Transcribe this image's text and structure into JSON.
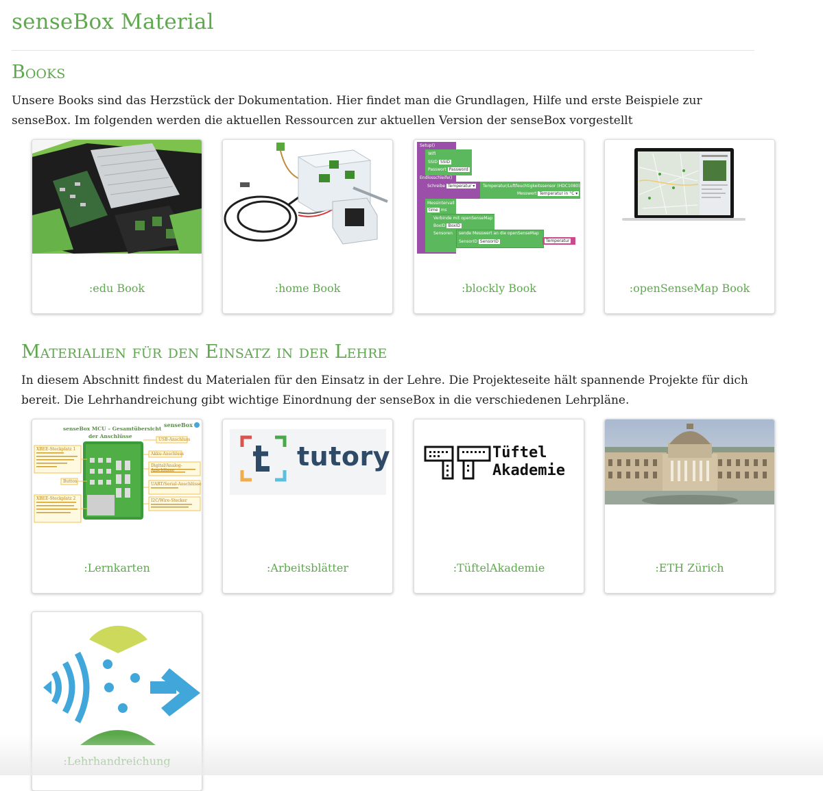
{
  "page": {
    "title": "senseBox Material"
  },
  "books": {
    "title": "Books",
    "description": "Unsere Books sind das Herzstück der Dokumentation. Hier findet man die Grundlagen, Hilfe und erste Beispiele zur senseBox. Im folgenden werden die aktuellen Ressourcen zur aktuellen Version der senseBox vorgestellt",
    "cards": [
      {
        "label": ":edu Book"
      },
      {
        "label": ":home Book"
      },
      {
        "label": ":blockly Book"
      },
      {
        "label": ":openSenseMap Book"
      }
    ]
  },
  "blockly_preview": {
    "setup": "Setup()",
    "wifi": "Wifi",
    "ssid": "SSID",
    "ssid_value": "SSID",
    "password": "Passwort",
    "password_value": "Password",
    "loop": "Endlosschleife()",
    "write": "Schreibe",
    "write_value": "Temperatur ▾",
    "sensor": "Temperatur/Luftfeuchtigkeitssensor (HDC1080)",
    "measure": "Messwert",
    "measure_value": "Temperatur in °C ▾",
    "interval": "Messintervall",
    "time": "time",
    "ms": "ms",
    "connect": "Verbinde mit openSenseMap",
    "boxid": "BoxID",
    "boxid_value": "BoxID",
    "sensors": "Sensoren",
    "send": "sende Messwert an die openSenseMap",
    "sensorid": "SensorID",
    "sensorid_value": "SensorID",
    "temp_value": "Temperatur"
  },
  "teaching": {
    "title": "Materialien für den Einsatz in der Lehre",
    "description": "In diesem Abschnitt findest du Materialen für den Einsatz in der Lehre. Die Projekteseite hält spannende Projekte für dich bereit. Die Lehrhandreichung gibt wichtige Einordnung der senseBox in die verschiedenen Lehrpläne.",
    "cards": [
      {
        "label": ":Lernkarten"
      },
      {
        "label": ":Arbeitsblätter"
      },
      {
        "label": ":TüftelAkademie"
      },
      {
        "label": ":ETH Zürich"
      },
      {
        "label": ":Lehrhandreichung"
      }
    ]
  },
  "lernkarten_preview": {
    "title_line1": "senseBox MCU – Gesamtübersicht",
    "title_line2": "der Anschlüsse",
    "brand": "senseBox",
    "usb": "USB-Anschluss",
    "akku": "Akku-Anschluss",
    "digital": "Digital/Analog-Anschlüsse",
    "uart": "UART/Serial-Anschlüsse",
    "i2c": "I2C/Wire-Stecker",
    "xbee1": "XBEE-Steckplatz 1",
    "button": "Button",
    "xbee2": "XBEE-Steckplatz 2"
  },
  "logos": {
    "tutory": "tutory",
    "tuftel_line1": "Tüftel",
    "tuftel_line2": "Akademie"
  },
  "colors": {
    "accent_green": "#5ea84e",
    "blockly_purple": "#9b4fa8",
    "blockly_green": "#5cb85c",
    "tutory_blue": "#2e4a67",
    "wave_blue": "#41a6d9",
    "lime": "#cdd95a"
  }
}
